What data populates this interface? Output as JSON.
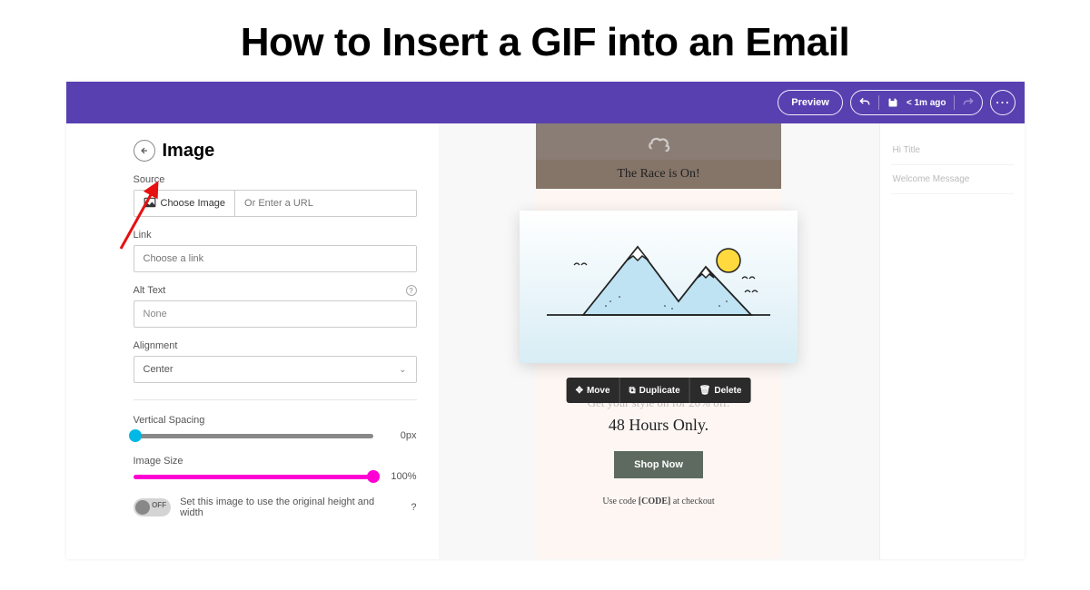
{
  "page_title": "How to Insert a GIF into an Email",
  "topbar": {
    "preview_label": "Preview",
    "autosave_text": "< 1m ago"
  },
  "panel": {
    "title": "Image",
    "source_label": "Source",
    "choose_image_label": "Choose Image",
    "url_placeholder": "Or Enter a URL",
    "link_label": "Link",
    "link_placeholder": "Choose a link",
    "alt_label": "Alt Text",
    "alt_value": "None",
    "alignment_label": "Alignment",
    "alignment_value": "Center",
    "vspacing_label": "Vertical Spacing",
    "vspacing_value": "0px",
    "imgsize_label": "Image Size",
    "imgsize_value": "100%",
    "toggle_state": "OFF",
    "toggle_desc": "Set this image to use the original height and width"
  },
  "preview": {
    "header_text": "The Race is On!",
    "toolbar": {
      "move": "Move",
      "duplicate": "Duplicate",
      "delete": "Delete"
    },
    "promo_line1": "Get your style on for 20% off.",
    "promo_line2": "48 Hours Only.",
    "shop_label": "Shop Now",
    "code_prefix": "Use code ",
    "code_value": "[CODE]",
    "code_suffix": " at checkout"
  },
  "right_sidebar": {
    "item1": "Hi Title",
    "item2": "Welcome Message"
  },
  "colors": {
    "accent_blue": "#00b8e6",
    "accent_pink": "#ff00d4",
    "topbar": "#5840b1"
  }
}
